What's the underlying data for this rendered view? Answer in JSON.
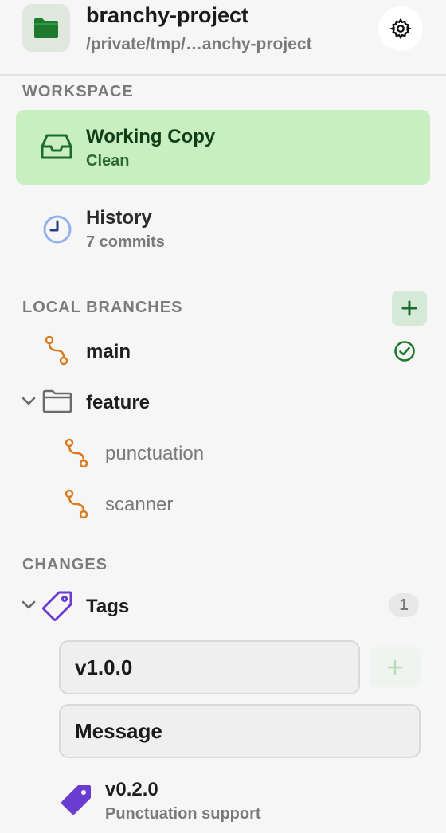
{
  "header": {
    "project_name": "branchy-project",
    "project_path": "/private/tmp/…anchy-project",
    "folder_icon": "folder-icon",
    "settings_icon": "gear-icon"
  },
  "workspace": {
    "section_label": "WORKSPACE",
    "working_copy": {
      "title": "Working Copy",
      "status": "Clean",
      "icon": "inbox-tray-icon"
    },
    "history": {
      "title": "History",
      "subtitle": "7 commits",
      "icon": "clock-icon"
    }
  },
  "local_branches": {
    "section_label": "LOCAL BRANCHES",
    "add_icon": "plus-icon",
    "items": [
      {
        "label": "main",
        "icon": "branch-icon",
        "current": true,
        "status_icon": "check-circle-icon"
      }
    ],
    "folders": [
      {
        "label": "feature",
        "icon": "folder-outline-icon",
        "expanded": true,
        "items": [
          {
            "label": "punctuation",
            "icon": "branch-icon"
          },
          {
            "label": "scanner",
            "icon": "branch-icon"
          }
        ]
      }
    ]
  },
  "changes": {
    "section_label": "CHANGES",
    "tags": {
      "label": "Tags",
      "count": "1",
      "icon": "tag-outline-icon",
      "expanded": true,
      "new_tag_name": "v1.0.0",
      "new_tag_message": "Message",
      "add_icon": "plus-icon",
      "items": [
        {
          "name": "v0.2.0",
          "message": "Punctuation support",
          "icon": "tag-filled-icon"
        }
      ]
    }
  },
  "colors": {
    "accent_green": "#1d7a2d",
    "selected_bg": "#c9efc1",
    "branch_orange": "#d87c1f",
    "tag_purple": "#6a3ccf",
    "history_blue": "#3b6fd6"
  }
}
